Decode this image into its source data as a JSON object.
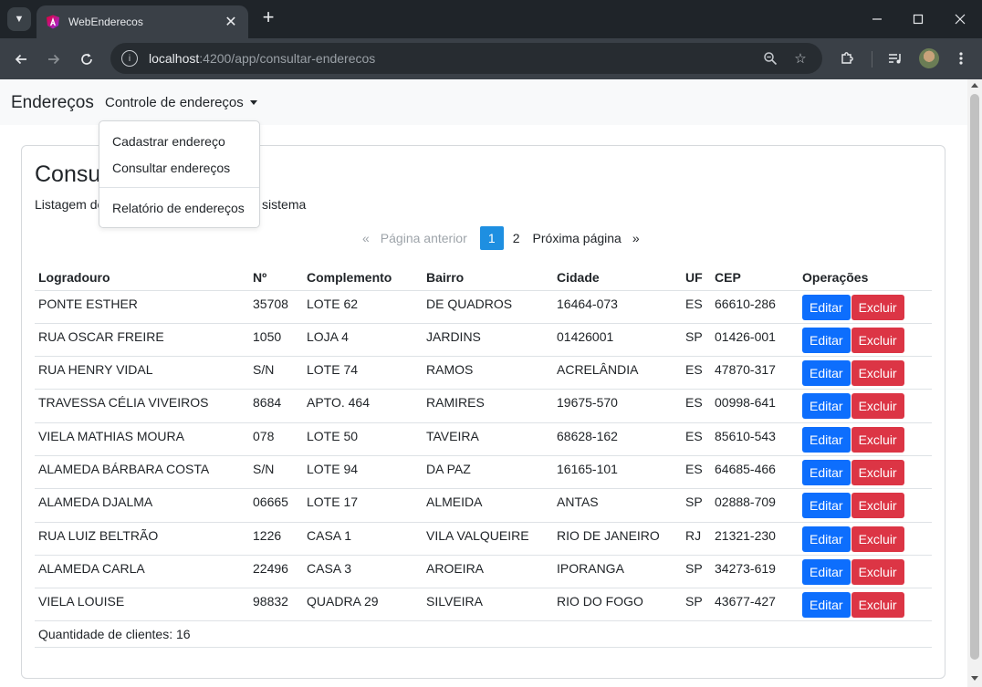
{
  "browser": {
    "tab_title": "WebEnderecos",
    "url_host": "localhost",
    "url_path": ":4200/app/consultar-enderecos"
  },
  "navbar": {
    "brand": "Endereços",
    "dropdown_label": "Controle de endereços",
    "menu": {
      "cadastrar": "Cadastrar endereço",
      "consultar": "Consultar endereços",
      "relatorio": "Relatório de endereços"
    }
  },
  "page": {
    "title": "Consultar endereços",
    "description": "Listagem de endereços cadastrados no sistema"
  },
  "pagination": {
    "prev_symbol": "«",
    "prev_label": "Página anterior",
    "pages": [
      "1",
      "2"
    ],
    "current_page": "1",
    "next_label": "Próxima página",
    "next_symbol": "»"
  },
  "table": {
    "headers": [
      "Logradouro",
      "Nº",
      "Complemento",
      "Bairro",
      "Cidade",
      "UF",
      "CEP",
      "Operações"
    ],
    "rows": [
      [
        "PONTE ESTHER",
        "35708",
        "LOTE 62",
        "DE QUADROS",
        "16464-073",
        "ES",
        "66610-286"
      ],
      [
        "RUA OSCAR FREIRE",
        "1050",
        "LOJA 4",
        "JARDINS",
        "01426001",
        "SP",
        "01426-001"
      ],
      [
        "RUA HENRY VIDAL",
        "S/N",
        "LOTE 74",
        "RAMOS",
        "ACRELÂNDIA",
        "ES",
        "47870-317"
      ],
      [
        "TRAVESSA CÉLIA VIVEIROS",
        "8684",
        "APTO. 464",
        "RAMIRES",
        "19675-570",
        "ES",
        "00998-641"
      ],
      [
        "VIELA MATHIAS MOURA",
        "078",
        "LOTE 50",
        "TAVEIRA",
        "68628-162",
        "ES",
        "85610-543"
      ],
      [
        "ALAMEDA BÁRBARA COSTA",
        "S/N",
        "LOTE 94",
        "DA PAZ",
        "16165-101",
        "ES",
        "64685-466"
      ],
      [
        "ALAMEDA DJALMA",
        "06665",
        "LOTE 17",
        "ALMEIDA",
        "ANTAS",
        "SP",
        "02888-709"
      ],
      [
        "RUA LUIZ BELTRÃO",
        "1226",
        "CASA 1",
        "VILA VALQUEIRE",
        "RIO DE JANEIRO",
        "RJ",
        "21321-230"
      ],
      [
        "ALAMEDA CARLA",
        "22496",
        "CASA 3",
        "AROEIRA",
        "IPORANGA",
        "SP",
        "34273-619"
      ],
      [
        "VIELA LOUISE",
        "98832",
        "QUADRA 29",
        "SILVEIRA",
        "RIO DO FOGO",
        "SP",
        "43677-427"
      ]
    ],
    "edit_label": "Editar",
    "delete_label": "Excluir",
    "footer": "Quantidade de clientes: 16"
  },
  "colors": {
    "primary": "#0d6efd",
    "danger": "#dc3545",
    "page_active": "#1e8fe1",
    "chrome_dark": "#1f2429",
    "chrome_toolbar": "#3a4047"
  }
}
